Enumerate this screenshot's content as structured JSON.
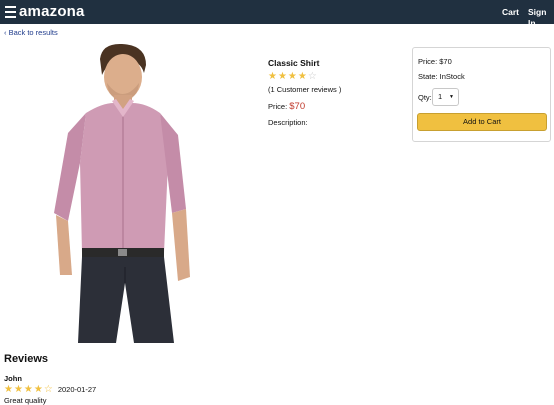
{
  "header": {
    "brand": "amazona",
    "cart_label": "Cart",
    "signin_label": "Sign In",
    "background": "#203040"
  },
  "back_link": "‹ Back to results",
  "product": {
    "name": "Classic Shirt",
    "rating_stars": "★★★★",
    "rating_empty": "☆",
    "reviews_text": "(1 Customer reviews )",
    "price_label": "Price:",
    "price_value": "$70",
    "description_label": "Description:"
  },
  "buy_box": {
    "price_text": "Price: $70",
    "state_text": "State: InStock",
    "qty_label": "Qty:",
    "qty_value": "1",
    "add_button": "Add to Cart",
    "button_color": "#f0c040"
  },
  "reviews": {
    "heading": "Reviews",
    "items": [
      {
        "name": "John",
        "stars": "★★★★",
        "empty": "☆",
        "date": "2020-01-27",
        "comment": "Great quality"
      }
    ]
  }
}
